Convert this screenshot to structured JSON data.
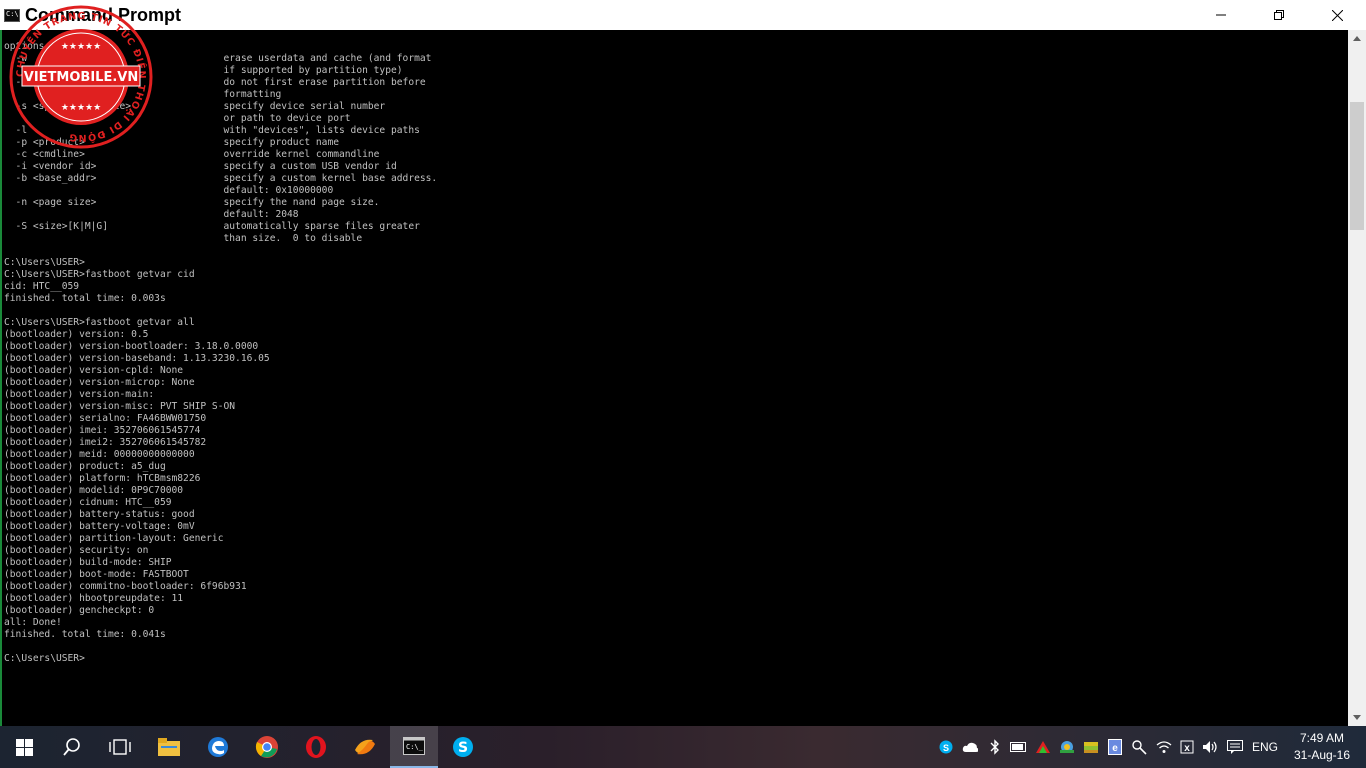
{
  "window": {
    "title": "Command Prompt",
    "controls": [
      "minimize-icon",
      "maximize-icon",
      "close-icon"
    ]
  },
  "watermark": {
    "brand": "VIETMOBILE.VN",
    "ring_text": "CHUYÊN TRANG TIN TỨC ĐIỆN THOẠI DI ĐỘNG",
    "color": "#e02020"
  },
  "console": {
    "text_color": "#c0c0c0",
    "background": "#000000",
    "lines": [
      "options:",
      "  -w                                  erase userdata and cache (and format",
      "                                      if supported by partition type)",
      "  -u                                  do not first erase partition before",
      "                                      formatting",
      "  -s <specific device>                specify device serial number",
      "                                      or path to device port",
      "  -l                                  with \"devices\", lists device paths",
      "  -p <product>                        specify product name",
      "  -c <cmdline>                        override kernel commandline",
      "  -i <vendor id>                      specify a custom USB vendor id",
      "  -b <base_addr>                      specify a custom kernel base address.",
      "                                      default: 0x10000000",
      "  -n <page size>                      specify the nand page size.",
      "                                      default: 2048",
      "  -S <size>[K|M|G]                    automatically sparse files greater",
      "                                      than size.  0 to disable",
      "",
      "C:\\Users\\USER>",
      "C:\\Users\\USER>fastboot getvar cid",
      "cid: HTC__059",
      "finished. total time: 0.003s",
      "",
      "C:\\Users\\USER>fastboot getvar all",
      "(bootloader) version: 0.5",
      "(bootloader) version-bootloader: 3.18.0.0000",
      "(bootloader) version-baseband: 1.13.3230.16.05",
      "(bootloader) version-cpld: None",
      "(bootloader) version-microp: None",
      "(bootloader) version-main:",
      "(bootloader) version-misc: PVT SHIP S-ON",
      "(bootloader) serialno: FA46BWW01750",
      "(bootloader) imei: 352706061545774",
      "(bootloader) imei2: 352706061545782",
      "(bootloader) meid: 00000000000000",
      "(bootloader) product: a5_dug",
      "(bootloader) platform: hTCBmsm8226",
      "(bootloader) modelid: 0P9C70000",
      "(bootloader) cidnum: HTC__059",
      "(bootloader) battery-status: good",
      "(bootloader) battery-voltage: 0mV",
      "(bootloader) partition-layout: Generic",
      "(bootloader) security: on",
      "(bootloader) build-mode: SHIP",
      "(bootloader) boot-mode: FASTBOOT",
      "(bootloader) commitno-bootloader: 6f96b931",
      "(bootloader) hbootpreupdate: 11",
      "(bootloader) gencheckpt: 0",
      "all: Done!",
      "finished. total time: 0.041s",
      "",
      "C:\\Users\\USER>"
    ]
  },
  "taskbar": {
    "pinned": [
      "windows-start-icon",
      "search-icon",
      "task-view-icon",
      "file-explorer-icon",
      "edge-icon",
      "chrome-icon",
      "opera-icon",
      "app-swirl-icon",
      "command-prompt-icon",
      "skype-icon"
    ],
    "active": "command-prompt-icon",
    "tray": [
      "app-s-icon",
      "onedrive-cloud-icon",
      "bluetooth-icon",
      "battery-icon",
      "network-app-icon",
      "colorful-app-icon",
      "books-icon",
      "document-icon",
      "tool-icon",
      "wifi-icon",
      "action-flag-icon",
      "volume-icon",
      "notifications-icon"
    ],
    "language": "ENG",
    "time": "7:49 AM",
    "date": "31-Aug-16"
  }
}
